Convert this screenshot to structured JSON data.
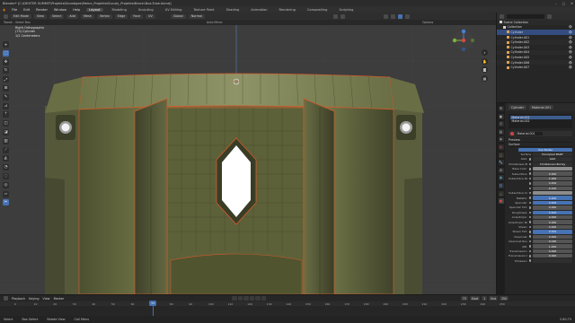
{
  "window": {
    "title": "Blender* [C:\\DEXTER SUMMIT\\Projekte\\Sonstiges\\Meine_Projekte\\Scouty_Projekte\\Barrel-Box-Tube.blend]"
  },
  "menu": [
    "File",
    "Edit",
    "Render",
    "Window",
    "Help"
  ],
  "workspaces": [
    "Layout",
    "Modeling",
    "Sculpting",
    "UV Editing",
    "Texture Paint",
    "Shading",
    "Animation",
    "Rendering",
    "Compositing",
    "Scripting"
  ],
  "active_workspace": "Layout",
  "scene": {
    "scene_name": "Scene",
    "layer_name": "View Layer"
  },
  "viewport_header": {
    "mode": "Edit Mode",
    "view": "View",
    "select": "Select",
    "add": "Add",
    "mesh": "Mesh",
    "vertex": "Vertex",
    "edge": "Edge",
    "face": "Face",
    "uv": "UV",
    "orientation": "Global",
    "pivot": "Normal"
  },
  "tool_settings": {
    "hint": "Tweak - Select Box",
    "mirror": "Auto Mirror",
    "snap": "Options"
  },
  "viewport_overlay": {
    "line1": "Right Orthographic",
    "line2": "(73) Cylinder",
    "line3": "1/2 Centimeters"
  },
  "npanel_tabs": [
    "Item",
    "Tool",
    "View",
    "Edit"
  ],
  "gizmo_buttons": [
    "zoom-icon",
    "pan-icon",
    "camera-icon",
    "grid-icon"
  ],
  "toolbar_icons": [
    "cursor",
    "select",
    "move",
    "rotate",
    "scale",
    "transform",
    "annotate",
    "measure",
    "extrude",
    "inset",
    "bevel",
    "loopcut",
    "knife",
    "polybuild",
    "spin",
    "smooth",
    "shrink",
    "shear",
    "rip"
  ],
  "outliner": {
    "items": [
      {
        "label": "Scene Collection",
        "color": "#cfcfcf",
        "selected": false
      },
      {
        "label": "Collection",
        "color": "#cfcfcf",
        "selected": false
      },
      {
        "label": "Cylinder",
        "color": "#e0a052",
        "selected": true
      },
      {
        "label": "Cylinder.001",
        "color": "#e0a052",
        "selected": false
      },
      {
        "label": "Cylinder.002",
        "color": "#e0a052",
        "selected": false
      },
      {
        "label": "Cylinder.003",
        "color": "#e0a052",
        "selected": false
      },
      {
        "label": "Cylinder.004",
        "color": "#e0a052",
        "selected": false
      },
      {
        "label": "Cylinder.005",
        "color": "#e0a052",
        "selected": false
      },
      {
        "label": "Cylinder.006",
        "color": "#e0a052",
        "selected": false
      },
      {
        "label": "Cylinder.007",
        "color": "#e0a052",
        "selected": false
      }
    ]
  },
  "properties": {
    "object_name": "Cylinder",
    "material_tab": "Material.001",
    "slots": [
      "Material.001",
      "Material.002"
    ],
    "material_name": "Material.001",
    "sections": {
      "preview": "Preview",
      "surface": "Surface",
      "use_nodes": "Use Nodes"
    },
    "surface_type": "Principled BSDF",
    "rows": [
      {
        "label": "GGX",
        "value": "GGX",
        "kind": "dark"
      },
      {
        "label": "Christensen-Burley",
        "value": "Christensen-Burley",
        "kind": "dark"
      },
      {
        "label": "Base Color",
        "value": "",
        "kind": "swatch"
      },
      {
        "label": "Subsurface",
        "value": "0.000",
        "kind": "plain"
      },
      {
        "label": "Subsurface Radius",
        "value": "1.000",
        "kind": "plain"
      },
      {
        "label": "",
        "value": "0.200",
        "kind": "plain"
      },
      {
        "label": "",
        "value": "0.100",
        "kind": "plain"
      },
      {
        "label": "Subsurface Color",
        "value": "",
        "kind": "swatch"
      },
      {
        "label": "Metallic",
        "value": "0.000",
        "kind": "blue"
      },
      {
        "label": "Specular",
        "value": "0.500",
        "kind": "blue"
      },
      {
        "label": "Specular Tint",
        "value": "0.000",
        "kind": "plain"
      },
      {
        "label": "Roughness",
        "value": "0.500",
        "kind": "blue"
      },
      {
        "label": "Anisotropic",
        "value": "0.000",
        "kind": "plain"
      },
      {
        "label": "Anisotropic Rotation",
        "value": "0.000",
        "kind": "plain"
      },
      {
        "label": "Sheen",
        "value": "0.000",
        "kind": "plain"
      },
      {
        "label": "Sheen Tint",
        "value": "0.500",
        "kind": "blue"
      },
      {
        "label": "Clearcoat",
        "value": "0.000",
        "kind": "plain"
      },
      {
        "label": "Clearcoat Roughness",
        "value": "0.030",
        "kind": "plain"
      },
      {
        "label": "IOR",
        "value": "1.450",
        "kind": "plain"
      },
      {
        "label": "Transmission",
        "value": "0.000",
        "kind": "plain"
      },
      {
        "label": "Transmission Rough.",
        "value": "0.000",
        "kind": "plain"
      },
      {
        "label": "Emission",
        "value": "",
        "kind": "dark"
      }
    ]
  },
  "timeline": {
    "menus": [
      "Playback",
      "Keying",
      "View",
      "Marker"
    ],
    "current_frame": "73",
    "start_label": "Start",
    "start": "1",
    "end_label": "End",
    "end": "250",
    "ticks": [
      "0",
      "10",
      "20",
      "30",
      "40",
      "50",
      "60",
      "70",
      "80",
      "90",
      "100",
      "110",
      "120",
      "130",
      "140",
      "150",
      "160",
      "170",
      "180",
      "190",
      "200",
      "210",
      "220",
      "230",
      "240",
      "250"
    ]
  },
  "statusbar": {
    "select": "Select",
    "box": "Box Select",
    "rotate": "Rotate View",
    "menu": "Call Menu",
    "version": "2.80.75"
  },
  "colors": {
    "accent": "#4772b3",
    "selection": "#ff8c00",
    "mesh": "#6b6f45"
  }
}
